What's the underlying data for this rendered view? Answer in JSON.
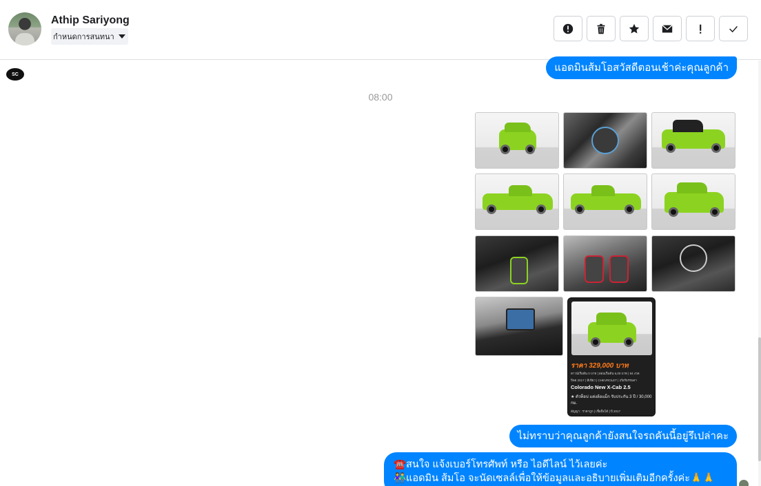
{
  "header": {
    "user_name": "Athip Sariyong",
    "conversation_label": "กำหนดการสนทนา",
    "actions": [
      {
        "name": "report-icon"
      },
      {
        "name": "trash-icon"
      },
      {
        "name": "star-icon"
      },
      {
        "name": "envelope-icon"
      },
      {
        "name": "exclamation-icon"
      },
      {
        "name": "check-icon"
      }
    ]
  },
  "messages": {
    "greeting": "แอดมินส้มโอสวัสดีตอนเช้าค่ะคุณลูกค้า",
    "time": "08:00",
    "question": "ไม่ทราบว่าคุณลูกค้ายังสนใจรถคันนี้อยู่รึเปล่าคะ",
    "contact_line1": "☎️สนใจ แจ้งเบอร์โทรศัพท์ หรือ ไอดีไลน์  ไว้เลยค่ะ",
    "contact_line2": "👫แอดมิน ส้มโอ จะนัดเซลล์เพื่อให้ข้อมูลและอธิบายเพิ่มเติมอีกครั้งค่ะ🙏🙏"
  },
  "promo_card": {
    "price": "ราคา 329,000 บาท",
    "down_line": "ดาวน์เริ่มต้น 0 บาท | ผ่อนเริ่มต้น 6,00 บาท | 84 งวด",
    "spec_line": "ปีจด 2017 | สีเขียว | CHEVROLET | เกียร์ธรรมดา",
    "model": "Colorado New X-Cab 2.5",
    "desc": "★ ตัวท็อป แต่งล้อแม็ก รับประกัน 3 ปี / 30,000 กม.",
    "footer": "สัญญา : ราคาถูก   |   เชื่อถือได้   |   ปี 2017"
  },
  "page_logo_text": "SC"
}
